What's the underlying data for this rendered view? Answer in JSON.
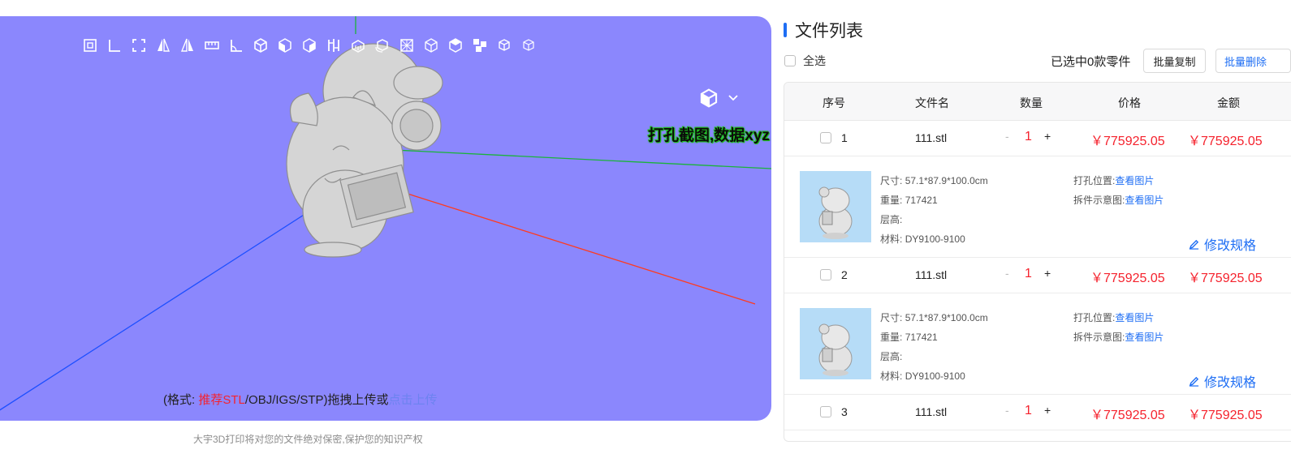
{
  "viewer": {
    "overlay_label": "打孔截图,数据xyz",
    "upload_prefix": "(格式: ",
    "upload_recommend": "推荐STL",
    "upload_formats": "/OBJ/IGS/STP)拖拽上传或",
    "upload_link": "点击上传",
    "privacy": "大宇3D打印将对您的文件绝对保密,保护您的知识产权",
    "toolbar_icons": [
      "fit-view-icon",
      "ruler-icon",
      "fullscreen-icon",
      "mirror-left-icon",
      "mirror-right-icon",
      "measure-icon",
      "angle-icon",
      "cube-icon",
      "cube-front-icon",
      "cube-side-icon",
      "section-icon",
      "support-icon",
      "cube-rotate-icon",
      "wireframe-icon",
      "cube-outline-icon",
      "cube-shaded-icon",
      "explode-icon",
      "cube-top-icon",
      "cube-iso-icon"
    ],
    "background_color": "#8b87fd"
  },
  "panel": {
    "title": "文件列表",
    "select_all": "全选",
    "selected_info": "已选中0款零件",
    "batch_copy": "批量复制",
    "batch_delete": "批量删除",
    "columns": [
      "序号",
      "文件名",
      "数量",
      "价格",
      "金额"
    ],
    "rows": [
      {
        "index": "1",
        "filename": "111.stl",
        "minus": "-",
        "qty": "1",
        "plus": "+",
        "price": "￥775925.05",
        "amount": "￥775925.05",
        "size_label": "尺寸:",
        "size": "57.1*87.9*100.0cm",
        "weight_label": "重量:",
        "weight": "717421",
        "layer_label": "层高:",
        "layer": "",
        "material_label": "材料:",
        "material": "DY9100-9100",
        "hole_label": "打孔位置:",
        "hole_link": "查看图片",
        "split_label": "拆件示意图:",
        "split_link": "查看图片",
        "modify": "修改规格"
      },
      {
        "index": "2",
        "filename": "111.stl",
        "minus": "-",
        "qty": "1",
        "plus": "+",
        "price": "￥775925.05",
        "amount": "￥775925.05",
        "size_label": "尺寸:",
        "size": "57.1*87.9*100.0cm",
        "weight_label": "重量:",
        "weight": "717421",
        "layer_label": "层高:",
        "layer": "",
        "material_label": "材料:",
        "material": "DY9100-9100",
        "hole_label": "打孔位置:",
        "hole_link": "查看图片",
        "split_label": "拆件示意图:",
        "split_link": "查看图片",
        "modify": "修改规格"
      },
      {
        "index": "3",
        "filename": "111.stl",
        "minus": "-",
        "qty": "1",
        "plus": "+",
        "price": "￥775925.05",
        "amount": "￥775925.05"
      }
    ],
    "accent_color": "#1e6ef4",
    "price_color": "#f5222d"
  }
}
